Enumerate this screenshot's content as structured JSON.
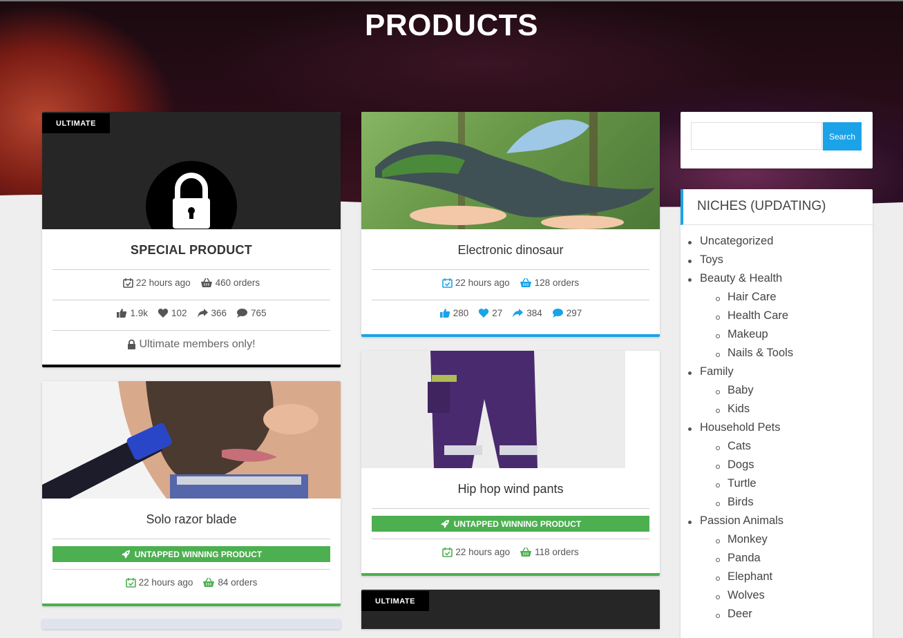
{
  "header": {
    "title": "PRODUCTS"
  },
  "products": [
    {
      "tag": "ULTIMATE",
      "title": "SPECIAL PRODUCT",
      "time": "22 hours ago",
      "orders": "460 orders",
      "likes": "1.9k",
      "loves": "102",
      "shares": "366",
      "comments": "765",
      "locked_text": "Ultimate members only!"
    },
    {
      "title": "Electronic dinosaur",
      "time": "22 hours ago",
      "orders": "128 orders",
      "likes": "280",
      "loves": "27",
      "shares": "384",
      "comments": "297"
    },
    {
      "title": "Solo razor blade",
      "badge": "UNTAPPED WINNING PRODUCT",
      "time": "22 hours ago",
      "orders": "84 orders"
    },
    {
      "title": "Hip hop wind pants",
      "badge": "UNTAPPED WINNING PRODUCT",
      "time": "22 hours ago",
      "orders": "118 orders"
    },
    {
      "tag": "ULTIMATE"
    }
  ],
  "sidebar": {
    "search": {
      "placeholder": "",
      "button_label": "Search"
    },
    "niches_title": "NICHES (UPDATING)",
    "niches": [
      {
        "label": "Uncategorized",
        "level": 0
      },
      {
        "label": "Toys",
        "level": 0
      },
      {
        "label": "Beauty & Health",
        "level": 0
      },
      {
        "label": "Hair Care",
        "level": 1
      },
      {
        "label": "Health Care",
        "level": 1
      },
      {
        "label": "Makeup",
        "level": 1
      },
      {
        "label": "Nails & Tools",
        "level": 1
      },
      {
        "label": "Family",
        "level": 0
      },
      {
        "label": "Baby",
        "level": 1
      },
      {
        "label": "Kids",
        "level": 1
      },
      {
        "label": "Household Pets",
        "level": 0
      },
      {
        "label": "Cats",
        "level": 1
      },
      {
        "label": "Dogs",
        "level": 1
      },
      {
        "label": "Turtle",
        "level": 1
      },
      {
        "label": "Birds",
        "level": 1
      },
      {
        "label": "Passion Animals",
        "level": 0
      },
      {
        "label": "Monkey",
        "level": 1
      },
      {
        "label": "Panda",
        "level": 1
      },
      {
        "label": "Elephant",
        "level": 1
      },
      {
        "label": "Wolves",
        "level": 1
      },
      {
        "label": "Deer",
        "level": 1
      }
    ]
  },
  "colors": {
    "accent_blue": "#1aa3e8",
    "winning_green": "#4caf50",
    "ultimate_black": "#000000"
  }
}
